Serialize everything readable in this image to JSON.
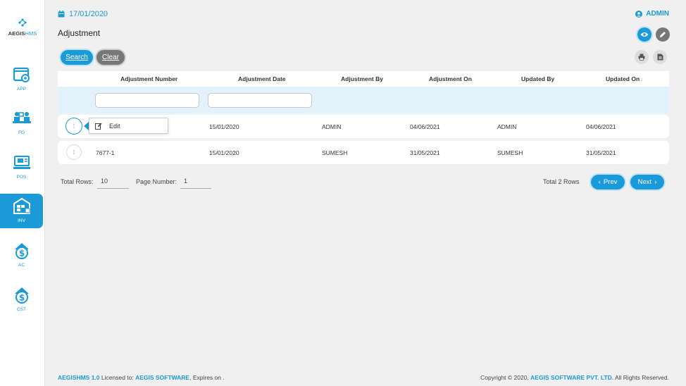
{
  "brand": {
    "logo_main": "AEGIS",
    "logo_accent": "HMS"
  },
  "sidebar": {
    "items": [
      {
        "label": "APP",
        "icon": "app-gear-icon",
        "active": false
      },
      {
        "label": "FO",
        "icon": "front-office-icon",
        "active": false
      },
      {
        "label": "POS",
        "icon": "pos-terminal-icon",
        "active": false
      },
      {
        "label": "INV",
        "icon": "inventory-icon",
        "active": true
      },
      {
        "label": "AC",
        "icon": "accounts-dollar-icon",
        "active": false
      },
      {
        "label": "CST",
        "icon": "cost-dollar-icon",
        "active": false
      }
    ]
  },
  "header": {
    "date": "17/01/2020",
    "user": "ADMIN",
    "page_title": "Adjustment"
  },
  "toolbar": {
    "search_label": "Search",
    "clear_label": "Clear"
  },
  "table": {
    "columns": [
      "Adjustment Number",
      "Adjustment Date",
      "Adjustment By",
      "Adjustment On",
      "Updated By",
      "Updated On"
    ],
    "sort_indicator": "↓",
    "row_menu_glyph": "⁞",
    "rows": [
      {
        "number": "",
        "date": "15/01/2020",
        "by": "ADMIN",
        "on": "04/06/2021",
        "updated_by": "ADMIN",
        "updated_on": "04/06/2021"
      },
      {
        "number": "7677-1",
        "date": "15/01/2020",
        "by": "SUMESH",
        "on": "31/05/2021",
        "updated_by": "SUMESH",
        "updated_on": "31/05/2021"
      }
    ],
    "row_menu": {
      "edit_label": "Edit"
    }
  },
  "pager": {
    "total_rows_label": "Total Rows:",
    "total_rows_value": "10",
    "page_number_label": "Page Number:",
    "page_number_value": "1",
    "total_text": "Total 2 Rows",
    "prev_label": "Prev",
    "next_label": "Next"
  },
  "footer": {
    "product": "AEGISHMS 1.0",
    "licensed_prefix": "Licensed to:",
    "licensee": "AEGIS SOFTWARE",
    "expires": ", Expires on .",
    "copyright": "Copyright © 2020,",
    "company": "AEGIS SOFTWARE PVT. LTD.",
    "rights": "All Rights Reserved."
  },
  "colors": {
    "accent": "#1a9ad6",
    "muted": "#777777",
    "filter_row": "#e3f1fa"
  }
}
